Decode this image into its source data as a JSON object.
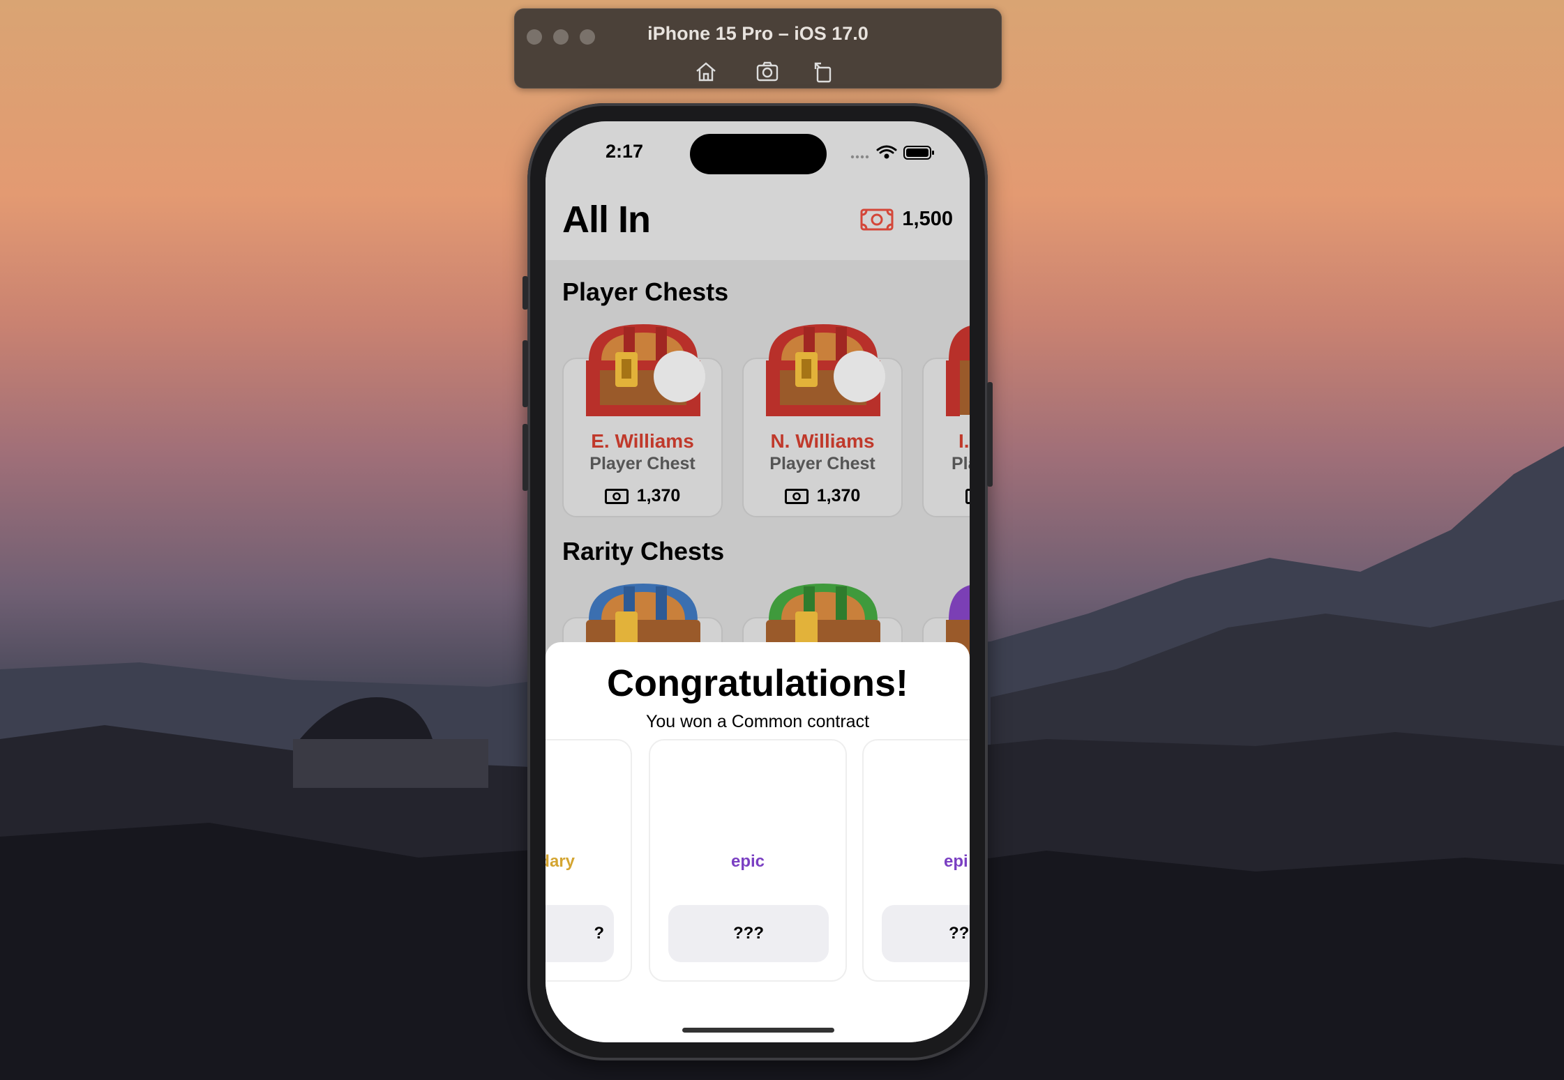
{
  "simulator": {
    "title": "iPhone 15 Pro – iOS 17.0",
    "toolbar_icons": [
      "home-icon",
      "screenshot-icon",
      "rotate-icon"
    ]
  },
  "status_bar": {
    "time": "2:17",
    "icons": [
      "signal-icon",
      "wifi-icon",
      "battery-icon"
    ]
  },
  "header": {
    "title": "All In",
    "balance": "1,500",
    "currency_icon": "cash-icon",
    "accent": "#d44638"
  },
  "sections": {
    "player_chests": {
      "title": "Player Chests",
      "cards": [
        {
          "name": "E. Williams",
          "type": "Player Chest",
          "price": "1,370"
        },
        {
          "name": "N. Williams",
          "type": "Player Chest",
          "price": "1,370"
        },
        {
          "name": "I.",
          "type": "Pla",
          "price": ""
        }
      ]
    },
    "rarity_chests": {
      "title": "Rarity Chests",
      "chest_colors": [
        "#3b6fb0",
        "#3f9a3c",
        "#7b3fb5"
      ]
    }
  },
  "modal": {
    "title": "Congratulations!",
    "subtitle": "You won a Common contract",
    "cards": [
      {
        "rarity": "dary",
        "color": "#d4a531",
        "button": "?"
      },
      {
        "rarity": "epic",
        "color": "#7a3fc2",
        "button": "???"
      },
      {
        "rarity": "epi",
        "color": "#7a3fc2",
        "button": "???"
      }
    ]
  }
}
